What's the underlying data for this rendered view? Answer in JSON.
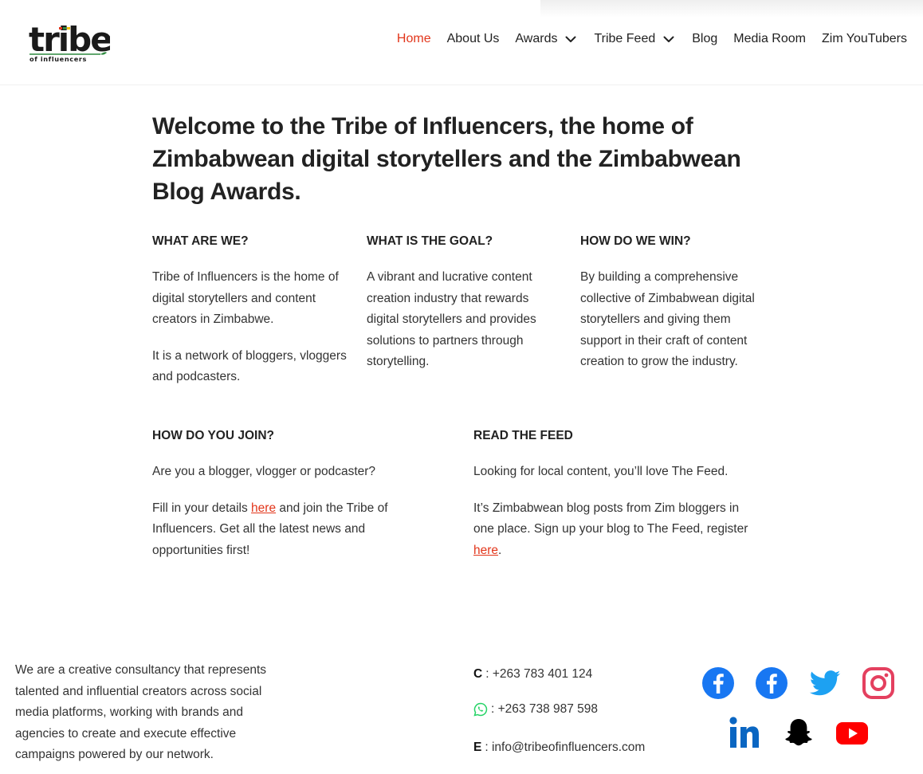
{
  "header": {
    "logo_text": "tribe",
    "logo_subtext": "of influencers",
    "nav": [
      {
        "label": "Home",
        "active": true,
        "dropdown": false
      },
      {
        "label": "About Us",
        "active": false,
        "dropdown": false
      },
      {
        "label": "Awards",
        "active": false,
        "dropdown": true
      },
      {
        "label": "Tribe Feed",
        "active": false,
        "dropdown": true
      },
      {
        "label": "Blog",
        "active": false,
        "dropdown": false
      },
      {
        "label": "Media Room",
        "active": false,
        "dropdown": false
      },
      {
        "label": "Zim YouTubers",
        "active": false,
        "dropdown": false
      }
    ]
  },
  "main": {
    "title": "Welcome to the Tribe of Influencers, the home of Zimbabwean digital storytellers and the Zimbabwean Blog Awards.",
    "what": {
      "heading": "WHAT ARE WE?",
      "p1": "Tribe of Influencers is the home of digital storytellers and content creators in Zimbabwe.",
      "p2": "It is a network of bloggers, vloggers and podcasters."
    },
    "goal": {
      "heading": "WHAT IS THE GOAL?",
      "p1": "A vibrant and lucrative content creation industry that rewards digital storytellers and provides solutions to partners through storytelling."
    },
    "win": {
      "heading": "HOW DO WE WIN?",
      "p1": "By building a comprehensive collective of Zimbabwean digital storytellers and giving them support in their craft of content creation to grow the industry."
    },
    "join": {
      "heading": "HOW DO YOU JOIN?",
      "p1": "Are you a blogger, vlogger or podcaster?",
      "p2_before": "Fill in your details ",
      "p2_link": "here",
      "p2_after": " and join the Tribe of Influencers. Get all the latest news and opportunities first!"
    },
    "feed": {
      "heading": "READ THE FEED",
      "p1": "Looking for local content, you’ll love The Feed.",
      "p2_before": "It’s Zimbabwean blog posts from Zim bloggers in one place. Sign up your blog to The Feed, register ",
      "p2_link": "here",
      "p2_after": "."
    }
  },
  "footer": {
    "about": "We are a creative consultancy that represents talented and influential creators across social media platforms, working with brands and agencies to create and execute effective campaigns powered by our network.",
    "contacts": {
      "call_label": "C",
      "call_value": ": +263 783 401 124",
      "whatsapp_value": ": +263 738 987 598",
      "email_label": "E",
      "email_value": ": info@tribeofinfluencers.com"
    },
    "social_icons": [
      "facebook-icon",
      "facebook-icon",
      "twitter-icon",
      "instagram-icon",
      "linkedin-icon",
      "snapchat-icon",
      "youtube-icon"
    ]
  },
  "colors": {
    "accent": "#e2361b",
    "facebook": "#1877f2",
    "twitter": "#1da1f2",
    "instagram": "#e4405f",
    "linkedin": "#0a66c2",
    "snapchat": "#000000",
    "youtube": "#ff0000",
    "whatsapp": "#25d366"
  }
}
